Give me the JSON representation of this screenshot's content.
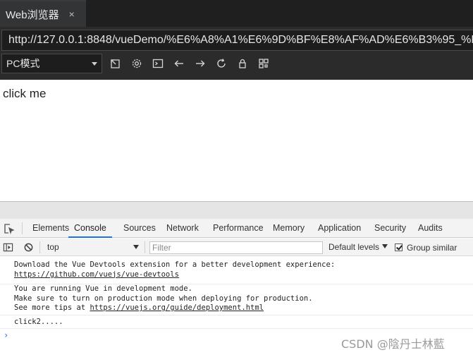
{
  "tab": {
    "title": "Web浏览器",
    "close": "×"
  },
  "url": "http://127.0.0.1:8848/vueDemo/%E6%A8%A1%E6%9D%BF%E8%AF%AD%E6%B3%95_%E6%",
  "toolbar": {
    "mode": "PC模式",
    "icons": [
      "open-external-icon",
      "settings-icon",
      "console-icon",
      "back-icon",
      "forward-icon",
      "refresh-icon",
      "lock-icon",
      "qr-code-icon"
    ]
  },
  "page": {
    "button_text": "click me"
  },
  "devtools": {
    "tabs": [
      "Elements",
      "Console",
      "Sources",
      "Network",
      "Performance",
      "Memory",
      "Application",
      "Security",
      "Audits"
    ],
    "active_tab": "Console",
    "context": "top",
    "filter_placeholder": "Filter",
    "levels": "Default levels",
    "group_similar": "Group similar",
    "group_similar_checked": true
  },
  "console": {
    "msg1_line1": "Download the Vue Devtools extension for a better development experience:",
    "msg1_link": "https://github.com/vuejs/vue-devtools",
    "msg2_line1": "You are running Vue in development mode.",
    "msg2_line2": "Make sure to turn on production mode when deploying for production.",
    "msg2_line3_prefix": "See more tips at ",
    "msg2_link": "https://vuejs.org/guide/deployment.html",
    "msg3": "click2.....",
    "prompt": "›"
  },
  "watermark": "CSDN @陰丹士林藍",
  "colors": {
    "accent": "#1a73e8",
    "chrome_bg": "#2b2b2b"
  }
}
